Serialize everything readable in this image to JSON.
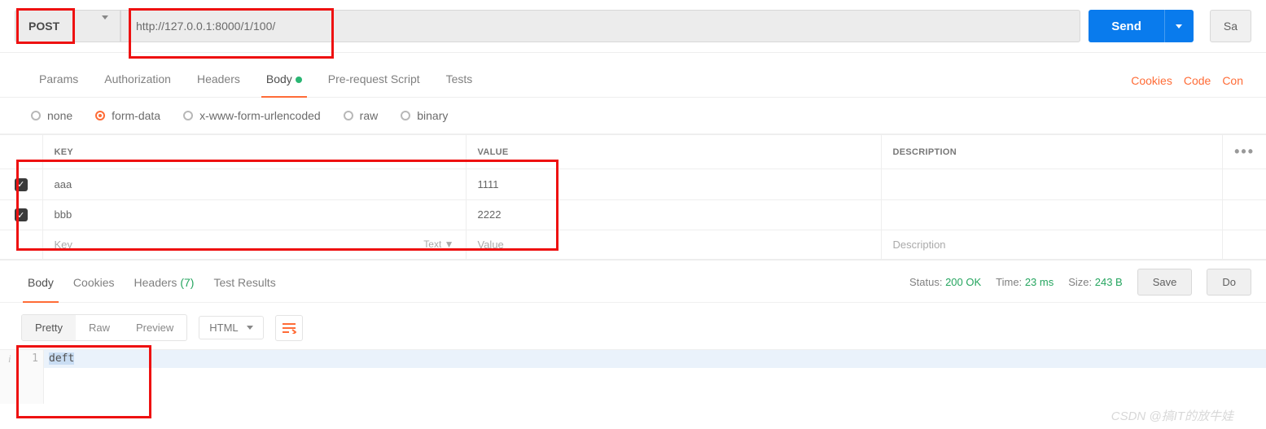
{
  "request": {
    "method": "POST",
    "url": "http://127.0.0.1:8000/1/100/",
    "send": "Send",
    "save": "Sa"
  },
  "tabs": {
    "params": "Params",
    "authorization": "Authorization",
    "headers": "Headers",
    "body": "Body",
    "prerequest": "Pre-request Script",
    "tests": "Tests"
  },
  "rightLinks": {
    "cookies": "Cookies",
    "code": "Code",
    "comments": "Con"
  },
  "bodyTypes": {
    "none": "none",
    "formdata": "form-data",
    "xwww": "x-www-form-urlencoded",
    "raw": "raw",
    "binary": "binary"
  },
  "kvTable": {
    "headers": {
      "key": "KEY",
      "value": "VALUE",
      "description": "DESCRIPTION"
    },
    "rows": [
      {
        "key": "aaa",
        "value": "1111"
      },
      {
        "key": "bbb",
        "value": "2222"
      }
    ],
    "placeholder": {
      "key": "Key",
      "value": "Value",
      "description": "Description",
      "typeSelector": "Text ▼"
    }
  },
  "responseTabs": {
    "body": "Body",
    "cookies": "Cookies",
    "headers": "Headers",
    "headersCount": "(7)",
    "testResults": "Test Results"
  },
  "responseMeta": {
    "statusLabel": "Status:",
    "statusValue": "200 OK",
    "timeLabel": "Time:",
    "timeValue": "23 ms",
    "sizeLabel": "Size:",
    "sizeValue": "243 B",
    "save": "Save",
    "download": "Do"
  },
  "viewModes": {
    "pretty": "Pretty",
    "raw": "Raw",
    "preview": "Preview",
    "format": "HTML"
  },
  "responseBody": {
    "lines": [
      {
        "n": "1",
        "text": "deft"
      }
    ]
  },
  "watermark": "CSDN @搞IT的放牛娃"
}
